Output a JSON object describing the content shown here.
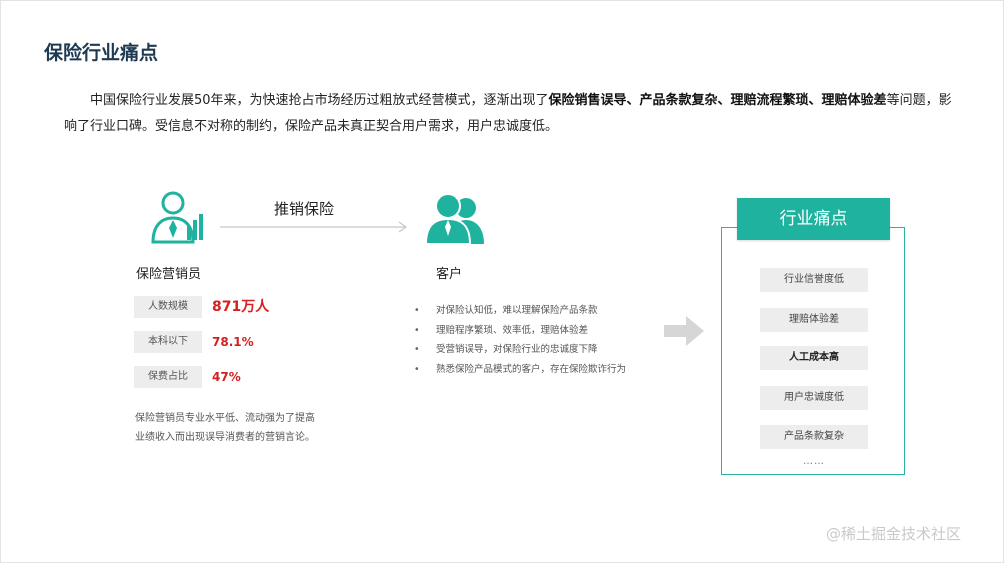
{
  "title": "保险行业痛点",
  "intro": {
    "p1": "中国保险行业发展50年来，为快速抢占市场经历过粗放式经营模式，逐渐出现了",
    "bold": "保险销售误导、产品条款复杂、理赔流程繁琐、理赔体验差",
    "p2": "等问题，影响了行业口碑。受信息不对称的制约，保险产品未真正契合用户需求，用户忠诚度低。"
  },
  "agent": {
    "icon": "salesperson-icon",
    "label": "保险营销员",
    "stats": [
      {
        "key": "人数规模",
        "value": "871万人"
      },
      {
        "key": "本科以下",
        "value": "78.1%"
      },
      {
        "key": "保费占比",
        "value": "47%"
      }
    ],
    "desc": "保险营销员专业水平低、流动强为了提高业绩收入而出现误导消费者的营销言论。"
  },
  "push": {
    "label": "推销保险",
    "icon": "arrow-right-icon"
  },
  "customer": {
    "icon": "customers-icon",
    "label": "客户",
    "bullets": [
      "对保险认知低，难以理解保险产品条款",
      "理赔程序繁琐、效率低，理赔体验差",
      "受营销误导，对保险行业的忠诚度下降",
      "熟悉保险产品模式的客户，存在保险欺诈行为"
    ]
  },
  "big_arrow_icon": "big-arrow-right-icon",
  "pain": {
    "header": "行业痛点",
    "items": [
      {
        "label": "行业信誉度低",
        "bold": false
      },
      {
        "label": "理赔体验差",
        "bold": false
      },
      {
        "label": "人工成本高",
        "bold": true
      },
      {
        "label": "用户忠诚度低",
        "bold": false
      },
      {
        "label": "产品条款复杂",
        "bold": false
      }
    ],
    "more": "……"
  },
  "watermark": "@稀土掘金技术社区",
  "colors": {
    "accent": "#1fb39f",
    "title": "#1d3a52",
    "highlight": "#d42020"
  }
}
